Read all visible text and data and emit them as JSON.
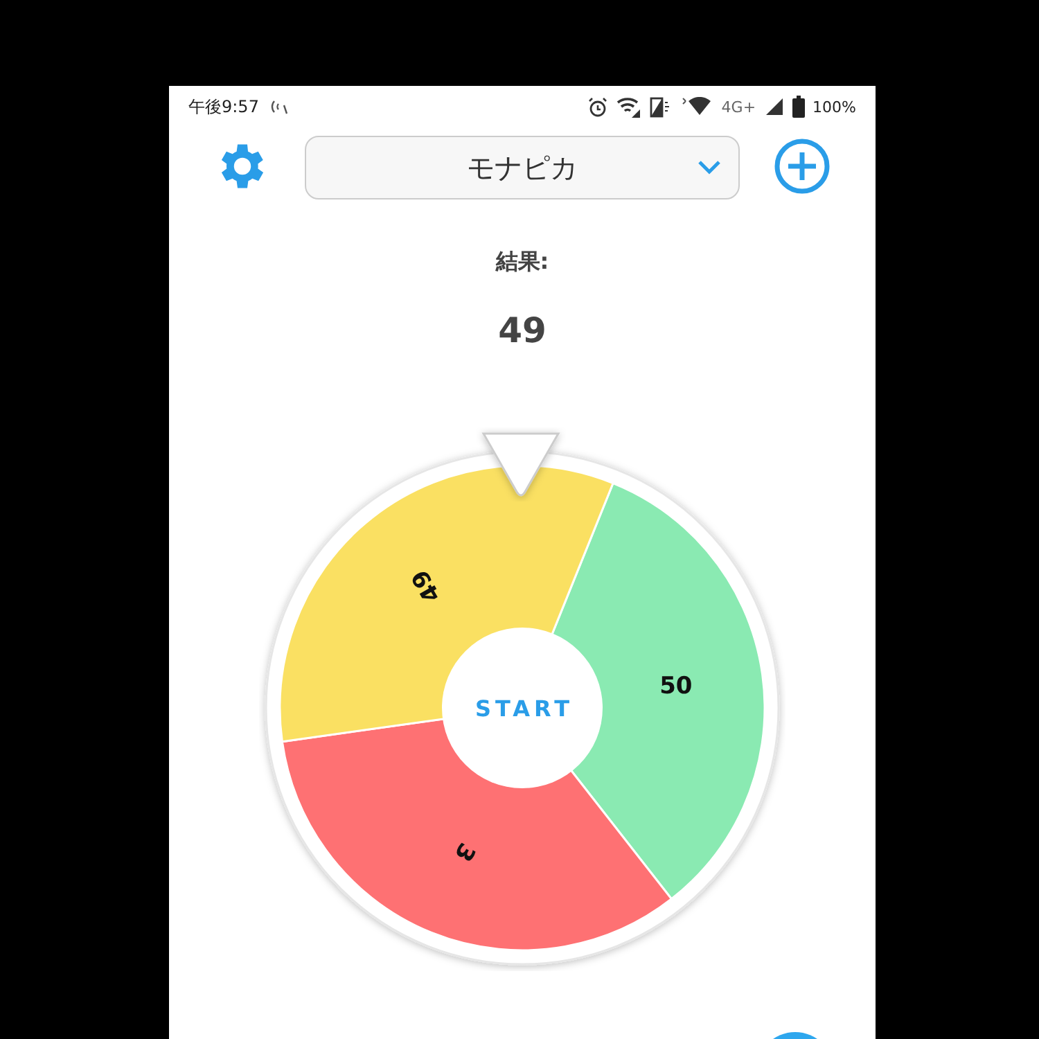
{
  "status_bar": {
    "time": "午後9:57",
    "network": "4G+",
    "battery": "100%"
  },
  "header": {
    "title": "モナピカ"
  },
  "result": {
    "label": "結果:",
    "value": "49"
  },
  "wheel": {
    "start_label": "START",
    "segments": [
      {
        "label": "50",
        "color": "#8aeab2"
      },
      {
        "label": "3",
        "color": "#fe7173"
      },
      {
        "label": "49",
        "color": "#fae062"
      }
    ]
  }
}
